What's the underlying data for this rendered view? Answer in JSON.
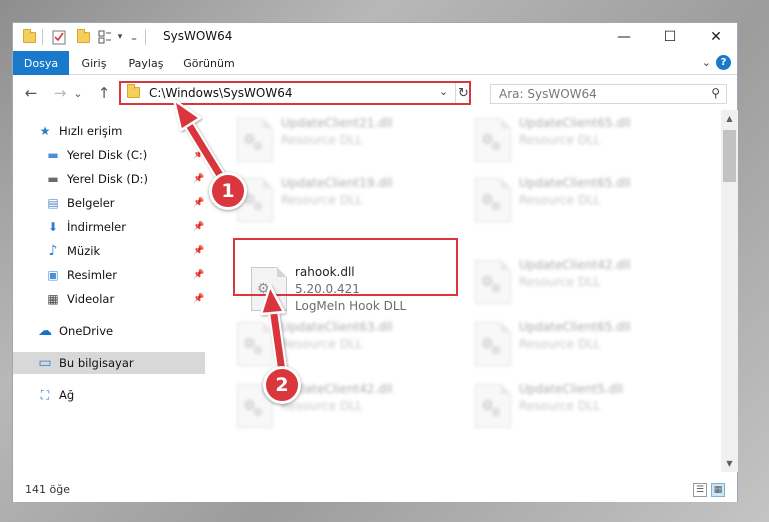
{
  "window": {
    "title": "SysWOW64",
    "minimize_glyph": "—",
    "maximize_glyph": "☐",
    "close_glyph": "✕"
  },
  "quick_access_toolbar": {
    "dropdown_glyph": "▾",
    "customize_glyph": "₌"
  },
  "ribbon": {
    "tabs": [
      {
        "label": "Dosya"
      },
      {
        "label": "Giriş"
      },
      {
        "label": "Paylaş"
      },
      {
        "label": "Görünüm"
      }
    ],
    "expand_glyph": "⌄",
    "help_glyph": "?"
  },
  "navigation": {
    "back_glyph": "←",
    "forward_glyph": "→",
    "recent_glyph": "⌄",
    "up_glyph": "↑",
    "address_path": "C:\\Windows\\SysWOW64",
    "address_dropdown_glyph": "⌄",
    "refresh_glyph": "↻",
    "search_placeholder": "Ara: SysWOW64",
    "search_glyph": "⚲"
  },
  "sidebar": {
    "pin_glyph": "📌",
    "items": [
      {
        "label": "Hızlı erişim",
        "icon": "star-icon",
        "glyph": "★",
        "color": "#2b7cd3"
      },
      {
        "label": "Yerel Disk (C:)",
        "icon": "drive-windows-icon",
        "glyph": "▬",
        "color": "#4a8fd6"
      },
      {
        "label": "Yerel Disk (D:)",
        "icon": "drive-icon",
        "glyph": "▬",
        "color": "#6b6b6b"
      },
      {
        "label": "Belgeler",
        "icon": "documents-icon",
        "glyph": "▤",
        "color": "#5a8ac4"
      },
      {
        "label": "İndirmeler",
        "icon": "downloads-icon",
        "glyph": "⬇",
        "color": "#2b7cd3"
      },
      {
        "label": "Müzik",
        "icon": "music-icon",
        "glyph": "♪",
        "color": "#2b7cd3"
      },
      {
        "label": "Resimler",
        "icon": "pictures-icon",
        "glyph": "▣",
        "color": "#4a8fd6"
      },
      {
        "label": "Videolar",
        "icon": "videos-icon",
        "glyph": "▦",
        "color": "#444444"
      },
      {
        "label": "OneDrive",
        "icon": "onedrive-icon",
        "glyph": "☁",
        "color": "#1a6fc9"
      },
      {
        "label": "Bu bilgisayar",
        "icon": "computer-icon",
        "glyph": "▭",
        "color": "#2b7cd3"
      },
      {
        "label": "Ağ",
        "icon": "network-icon",
        "glyph": "⛶",
        "color": "#2b7cd3"
      }
    ]
  },
  "files": [
    {
      "name": "UpdateClient21.dll",
      "line2": "Resource DLL",
      "line3": "",
      "blurred": true
    },
    {
      "name": "UpdateClient65.dll",
      "line2": "Resource DLL",
      "line3": "",
      "blurred": true
    },
    {
      "name": "UpdateClient19.dll",
      "line2": "Resource DLL",
      "line3": "",
      "blurred": true
    },
    {
      "name": "UpdateClient65.dll",
      "line2": "Resource DLL",
      "line3": "",
      "blurred": true
    },
    {
      "name": "rahook.dll",
      "line2": "5.20.0.421",
      "line3": "LogMeIn Hook DLL",
      "blurred": false
    },
    {
      "name": "UpdateClient42.dll",
      "line2": "Resource DLL",
      "line3": "",
      "blurred": true
    },
    {
      "name": "UpdateClient63.dll",
      "line2": "Resource DLL",
      "line3": "",
      "blurred": true
    },
    {
      "name": "UpdateClient65.dll",
      "line2": "Resource DLL",
      "line3": "",
      "blurred": true
    },
    {
      "name": "UpdateClient42.dll",
      "line2": "Resource DLL",
      "line3": "",
      "blurred": true
    },
    {
      "name": "UpdateClient5.dll",
      "line2": "Resource DLL",
      "line3": "",
      "blurred": true
    }
  ],
  "file_icon_glyph": "⚙",
  "scrollbar": {
    "up_glyph": "▲",
    "down_glyph": "▼"
  },
  "status_bar": {
    "item_count": "141 öğe",
    "details_view_glyph": "☰",
    "tiles_view_glyph": "▦"
  },
  "annotations": {
    "color": "#d9363e",
    "step1": "1",
    "step2": "2"
  }
}
